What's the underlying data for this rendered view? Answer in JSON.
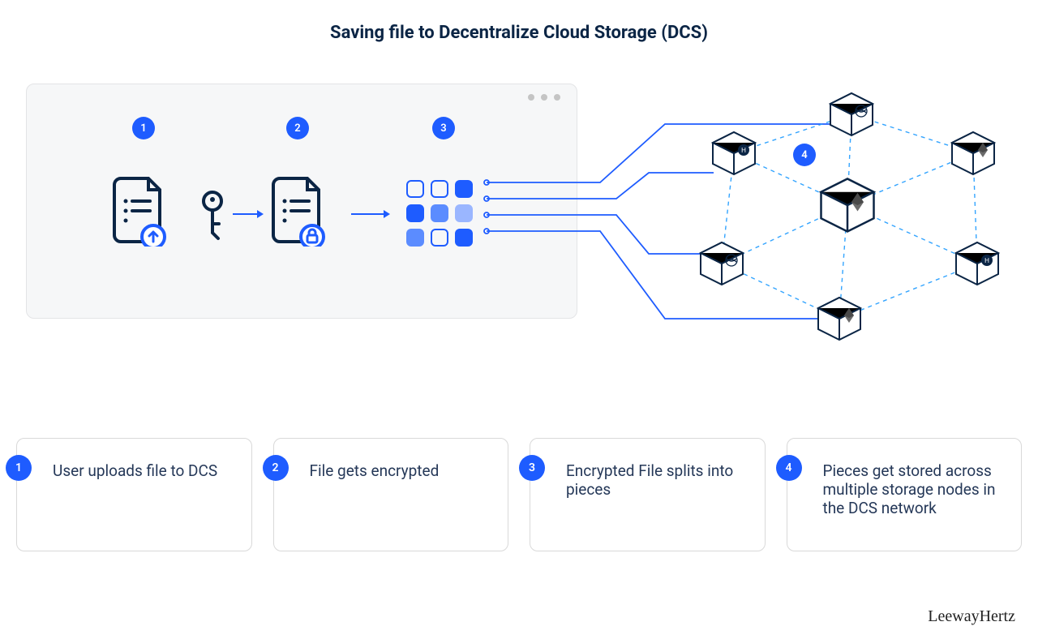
{
  "title": "Saving file to Decentralize Cloud Storage (DCS)",
  "attribution": "LeewayHertz",
  "top_badges": {
    "b1": "1",
    "b2": "2",
    "b3": "3",
    "b4": "4"
  },
  "steps": [
    {
      "num": "1",
      "text": "User uploads file to DCS"
    },
    {
      "num": "2",
      "text": "File gets encrypted"
    },
    {
      "num": "3",
      "text": "Encrypted File splits into pieces"
    },
    {
      "num": "4",
      "text": "Pieces get stored across multiple storage nodes in the DCS network"
    }
  ],
  "colors": {
    "accent": "#1e5cff",
    "dark": "#0b2545",
    "window_bg": "#f6f7f8",
    "card_border": "#d9d9d9"
  },
  "icons": {
    "file_upload": "file-upload-icon",
    "key": "key-icon",
    "file_locked": "file-locked-icon",
    "arrow": "arrow-right-icon",
    "grid": "pieces-grid-icon",
    "cube": "storage-cube-icon"
  }
}
